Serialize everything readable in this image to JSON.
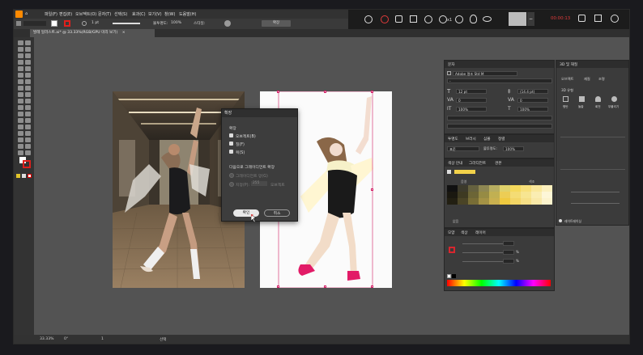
{
  "menu": {
    "items": [
      "파일(F)",
      "편집(E)",
      "오브젝트(O)",
      "문자(T)",
      "선택(S)",
      "효과(C)",
      "보기(V)",
      "창(W)",
      "도움말(H)"
    ]
  },
  "overlay": {
    "recording_label": "00:00:13",
    "zoom_label": "x1"
  },
  "options_bar": {
    "stroke_weight": "1 pt",
    "opacity_label": "불투명도:",
    "opacity_value": "100%",
    "style_label": "스타일:",
    "button_label": "확장"
  },
  "document_tab": {
    "title": "발레 일러스트.ai* @ 33.33%(RGB/GPU 미리 보기)",
    "close": "×"
  },
  "dialog": {
    "title": "확장",
    "section_expand": "확장",
    "opt_object": "오브젝트(B)",
    "opt_fill": "칠(F)",
    "opt_stroke": "획(S)",
    "section_gradient": "다음으로 그레이디언트 확장",
    "opt_gradient_mesh": "그레이디언트 망(G)",
    "opt_specify": "지정(P):",
    "opt_specify_value": "255",
    "opt_objects_unit": "오브젝트",
    "ok": "확인",
    "cancel": "취소"
  },
  "char_panel": {
    "title": "문자",
    "font_name": "Adobe 명조 Std M",
    "style_placeholder": "-",
    "font_size": "12 pt",
    "leading": "(14.4 pt)",
    "kerning": "0",
    "tracking": "0",
    "scale_v": "100%",
    "scale_h": "100%"
  },
  "swatch_panel": {
    "tabs": [
      "투명도",
      "브러시",
      "심볼",
      "정렬"
    ],
    "mode": "표준",
    "opacity_label": "불투명도:",
    "opacity_value": "100%"
  },
  "color_guide_panel": {
    "tabs": [
      "색상 안내",
      "그라디언트",
      "견본"
    ],
    "left_label": "음영",
    "right_label": "색조",
    "bottom_label": "없음",
    "colors": {
      "base": "#f2d14a",
      "row1": [
        "#111111",
        "#3c3a2c",
        "#65613f",
        "#8e8752",
        "#b7ad60",
        "#e0d26b",
        "#f5d95c",
        "#f8e07a",
        "#fae89c",
        "#fcf0be"
      ],
      "row2": [
        "#1a1810",
        "#3e3a22",
        "#6c6536",
        "#968b44",
        "#c1b052",
        "#eccd55",
        "#f4dc74",
        "#f7e591",
        "#faedb2",
        "#fdf6d7"
      ],
      "row3": [
        "#221f12",
        "#4a4426",
        "#786d36",
        "#a49245",
        "#c9b04f",
        "#efc93f",
        "#f3d565",
        "#f6df86",
        "#f9e9a8",
        "#fcf3cd"
      ]
    }
  },
  "color_panel": {
    "tabs": [
      "모양",
      "색상",
      "레이어"
    ],
    "unit": "%",
    "stroke_color": "#d8262e"
  },
  "properties_panel": {
    "tabs": [
      "3D 및 재질"
    ],
    "sub_tabs": [
      "오브젝트",
      "재질",
      "조명"
    ],
    "section_3d": "3D 유형",
    "options": [
      "평탄",
      "돌출",
      "회전",
      "부풀리기"
    ],
    "footer": "레이트레이싱"
  },
  "status": {
    "zoom": "33.33%",
    "angle": "0°",
    "page": "1",
    "tool": "선택"
  },
  "tool_colors": {
    "fill": "#ffffff",
    "stroke": "#e0201c"
  }
}
